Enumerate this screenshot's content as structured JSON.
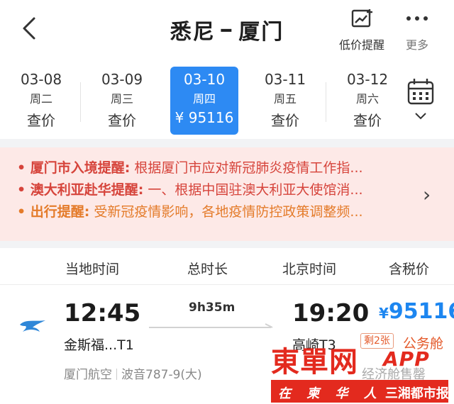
{
  "header": {
    "from": "悉尼",
    "to": "厦门",
    "separator": "━",
    "price_alert_label": "低价提醒",
    "more_label": "更多"
  },
  "dates": [
    {
      "date": "03-08",
      "weekday": "周二",
      "price": "查价",
      "active": false
    },
    {
      "date": "03-09",
      "weekday": "周三",
      "price": "查价",
      "active": false
    },
    {
      "date": "03-10",
      "weekday": "周四",
      "price": "¥ 95116",
      "active": true
    },
    {
      "date": "03-11",
      "weekday": "周五",
      "price": "查价",
      "active": false
    },
    {
      "date": "03-12",
      "weekday": "周六",
      "price": "查价",
      "active": false
    }
  ],
  "notices": [
    {
      "title": "厦门市入境提醒:",
      "text": " 根据厦门市应对新冠肺炎疫情工作指...",
      "color": "#d6443b"
    },
    {
      "title": "澳大利亚赴华提醒:",
      "text": " 一、根据中国驻澳大利亚大使馆消...",
      "color": "#d6443b"
    },
    {
      "title": "出行提醒:",
      "text": " 受新冠疫情影响，各地疫情防控政策调整频...",
      "color": "#e47b2a"
    }
  ],
  "columns": {
    "local_time": "当地时间",
    "duration": "总时长",
    "beijing_time": "北京时间",
    "price_incl_tax": "含税价"
  },
  "flight": {
    "dep_time": "12:45",
    "arr_time": "19:20",
    "duration": "9h35m",
    "price_currency": "¥",
    "price": "95116",
    "dep_airport": "金斯福...T1",
    "arr_airport": "高崎T3",
    "seats_left": "剩2张",
    "cabin": "公务舱",
    "airline": "厦门航空",
    "aircraft": "波音787-9(大)",
    "economy_status": "经济舱售罄"
  },
  "watermark": {
    "brand": "東單网",
    "app": "APP",
    "slogan": "在 柬 华 人",
    "partner": "三湘都市报"
  },
  "colors": {
    "accent": "#2d8af3",
    "price": "#1d86f0",
    "notice_bg": "#fde9e7",
    "alert_red": "#d6443b",
    "alert_orange": "#e47b2a"
  }
}
